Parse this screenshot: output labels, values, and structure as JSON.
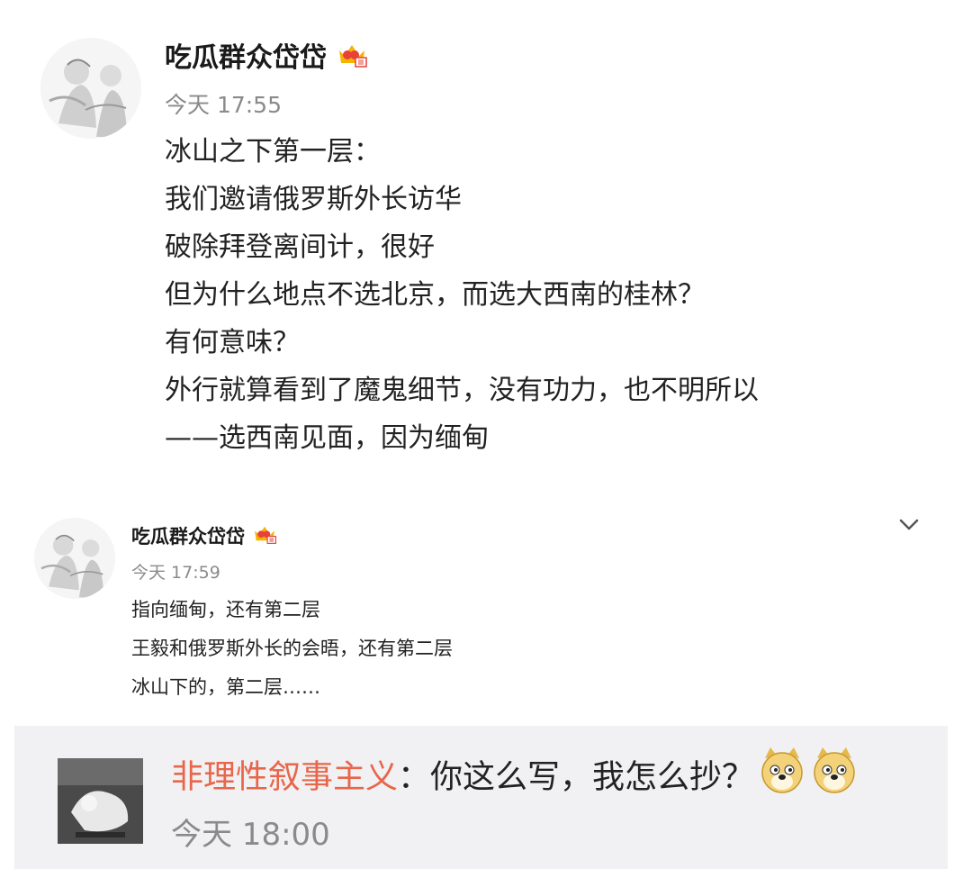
{
  "posts": [
    {
      "username": "吃瓜群众岱岱",
      "badge_icon": "vip-crown-icon",
      "time": "今天 17:55",
      "lines": [
        "冰山之下第一层：",
        "我们邀请俄罗斯外长访华",
        "破除拜登离间计，很好",
        "但为什么地点不选北京，而选大西南的桂林？",
        "有何意味？",
        "外行就算看到了魔鬼细节，没有功力，也不明所以",
        "——选西南见面，因为缅甸"
      ]
    },
    {
      "username": "吃瓜群众岱岱",
      "badge_icon": "vip-crown-icon",
      "time": "今天 17:59",
      "lines": [
        "指向缅甸，还有第二层",
        "王毅和俄罗斯外长的会晤，还有第二层",
        "冰山下的，第二层……"
      ],
      "menu_icon": "chevron-down-icon"
    }
  ],
  "reply": {
    "name": "非理性叙事主义",
    "separator": "：",
    "text": "你这么写，我怎么抄？",
    "emoji": [
      "doge-emoji",
      "doge-emoji"
    ],
    "time": "今天 18:00"
  },
  "colors": {
    "reply_name": "#e8664a",
    "time_gray": "#8a8a8a",
    "reply_bg": "#f1f1f3"
  }
}
